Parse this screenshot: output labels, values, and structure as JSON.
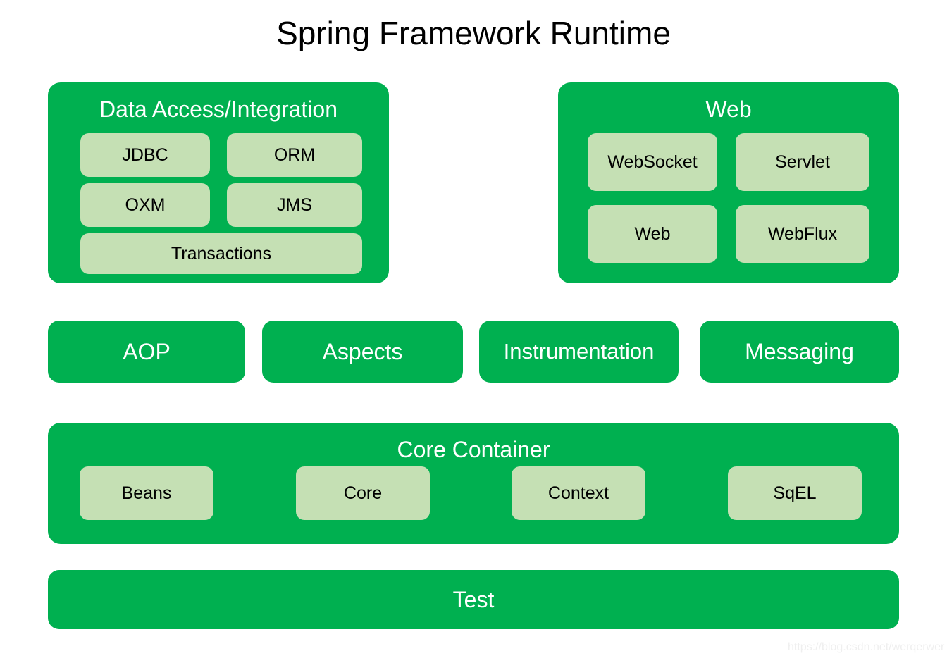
{
  "title": "Spring Framework Runtime",
  "colors": {
    "panel_green": "#00B050",
    "module_light_green": "#C5E0B4",
    "panel_text": "#FFFFFF",
    "module_text": "#000000",
    "title_text": "#000000",
    "background": "#FFFFFF",
    "watermark_text": "#EFEFEF"
  },
  "data_access": {
    "title": "Data Access/Integration",
    "modules": [
      {
        "label": "JDBC"
      },
      {
        "label": "ORM"
      },
      {
        "label": "OXM"
      },
      {
        "label": "JMS"
      },
      {
        "label": "Transactions"
      }
    ]
  },
  "web": {
    "title": "Web",
    "modules": [
      {
        "label": "WebSocket"
      },
      {
        "label": "Servlet"
      },
      {
        "label": "Web"
      },
      {
        "label": "WebFlux"
      }
    ]
  },
  "middle_row": {
    "bars": [
      {
        "label": "AOP"
      },
      {
        "label": "Aspects"
      },
      {
        "label": "Instrumentation"
      },
      {
        "label": "Messaging"
      }
    ]
  },
  "core_container": {
    "title": "Core Container",
    "modules": [
      {
        "label": "Beans"
      },
      {
        "label": "Core"
      },
      {
        "label": "Context"
      },
      {
        "label": "SqEL"
      }
    ]
  },
  "test": {
    "label": "Test"
  },
  "watermark": {
    "text": "https://blog.csdn.net/werqerwer"
  }
}
